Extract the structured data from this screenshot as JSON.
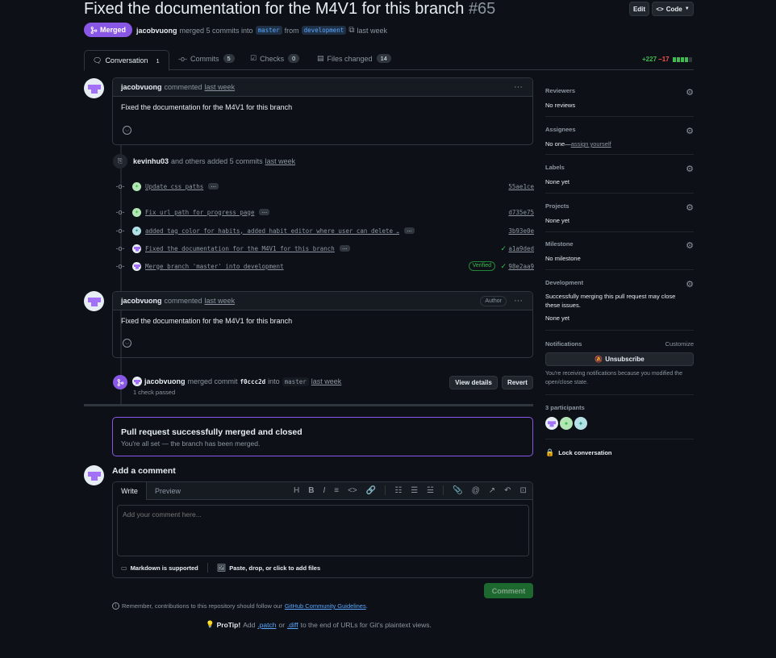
{
  "header": {
    "title": "Fixed the documentation for the M4V1 for this branch",
    "number": "#65",
    "edit_label": "Edit",
    "code_label": "Code",
    "state_label": "Merged",
    "author": "jacobvuong",
    "merge_text": "merged 5 commits into",
    "base_branch": "master",
    "from_text": "from",
    "head_branch": "development",
    "time": "last week"
  },
  "tabs": [
    {
      "label": "Conversation",
      "count": "1"
    },
    {
      "label": "Commits",
      "count": "5"
    },
    {
      "label": "Checks",
      "count": "0"
    },
    {
      "label": "Files changed",
      "count": "14"
    }
  ],
  "diffstat": {
    "additions": "+227",
    "deletions": "−17"
  },
  "comment1": {
    "author": "jacobvuong",
    "action": "commented",
    "time": "last week",
    "body": "Fixed the documentation for the M4V1 for this branch"
  },
  "commits_event": {
    "author": "kevinhu03",
    "text": "and others added 5 commits",
    "time": "last week"
  },
  "commits": [
    {
      "message": "Update css paths",
      "sha": "55ae1ce",
      "verified": ""
    },
    {
      "message": "Fix url path for progress page",
      "sha": "d735e75",
      "verified": ""
    },
    {
      "message": "added tag color for habits, added habit editor where user can delete …",
      "sha": "3b93e0e",
      "verified": ""
    },
    {
      "message": "Fixed the documentation for the M4V1 for this branch",
      "sha": "a1a9ded",
      "verified": ""
    },
    {
      "message": "Merge branch 'master' into development",
      "sha": "98e2aa9",
      "verified": "Verified"
    }
  ],
  "comment2": {
    "author": "jacobvuong",
    "action": "commented",
    "time": "last week",
    "badge": "Author",
    "body": "Fixed the documentation for the M4V1 for this branch"
  },
  "merge_event": {
    "author": "jacobvuong",
    "text": "merged commit",
    "sha": "f0ccc2d",
    "into": "into",
    "branch": "master",
    "time": "last week",
    "checks": "1 check passed",
    "view_details": "View details",
    "revert": "Revert"
  },
  "merged_box": {
    "title": "Pull request successfully merged and closed",
    "subtitle": "You're all set — the branch has been merged."
  },
  "add_comment": {
    "heading": "Add a comment",
    "write_tab": "Write",
    "preview_tab": "Preview",
    "placeholder": "Add your comment here...",
    "markdown_note": "Markdown is supported",
    "attach_note": "Paste, drop, or click to add files",
    "submit": "Comment"
  },
  "footer": {
    "guidelines_prefix": "Remember, contributions to this repository should follow our",
    "guidelines_link": "GitHub Community Guidelines",
    "guidelines_suffix": ".",
    "protip_label": "ProTip!",
    "protip_add": "Add",
    "patch": ".patch",
    "or": "or",
    "diff": ".diff",
    "protip_rest": "to the end of URLs for Git's plaintext views."
  },
  "sidebar": {
    "reviewers": {
      "title": "Reviewers",
      "value": "No reviews"
    },
    "assignees": {
      "title": "Assignees",
      "value": "No one—",
      "link": "assign yourself"
    },
    "labels": {
      "title": "Labels",
      "value": "None yet"
    },
    "projects": {
      "title": "Projects",
      "value": "None yet"
    },
    "milestone": {
      "title": "Milestone",
      "value": "No milestone"
    },
    "development": {
      "title": "Development",
      "value": "Successfully merging this pull request may close these issues.",
      "value2": "None yet"
    },
    "notifications": {
      "title": "Notifications",
      "customize": "Customize",
      "button": "Unsubscribe",
      "note": "You're receiving notifications because you modified the open/close state."
    },
    "participants": {
      "title": "3 participants"
    },
    "lock": "Lock conversation"
  },
  "colors": {
    "merged": "#8957e5",
    "success": "#238636",
    "link": "#58a6ff",
    "bg": "#0d1117"
  }
}
